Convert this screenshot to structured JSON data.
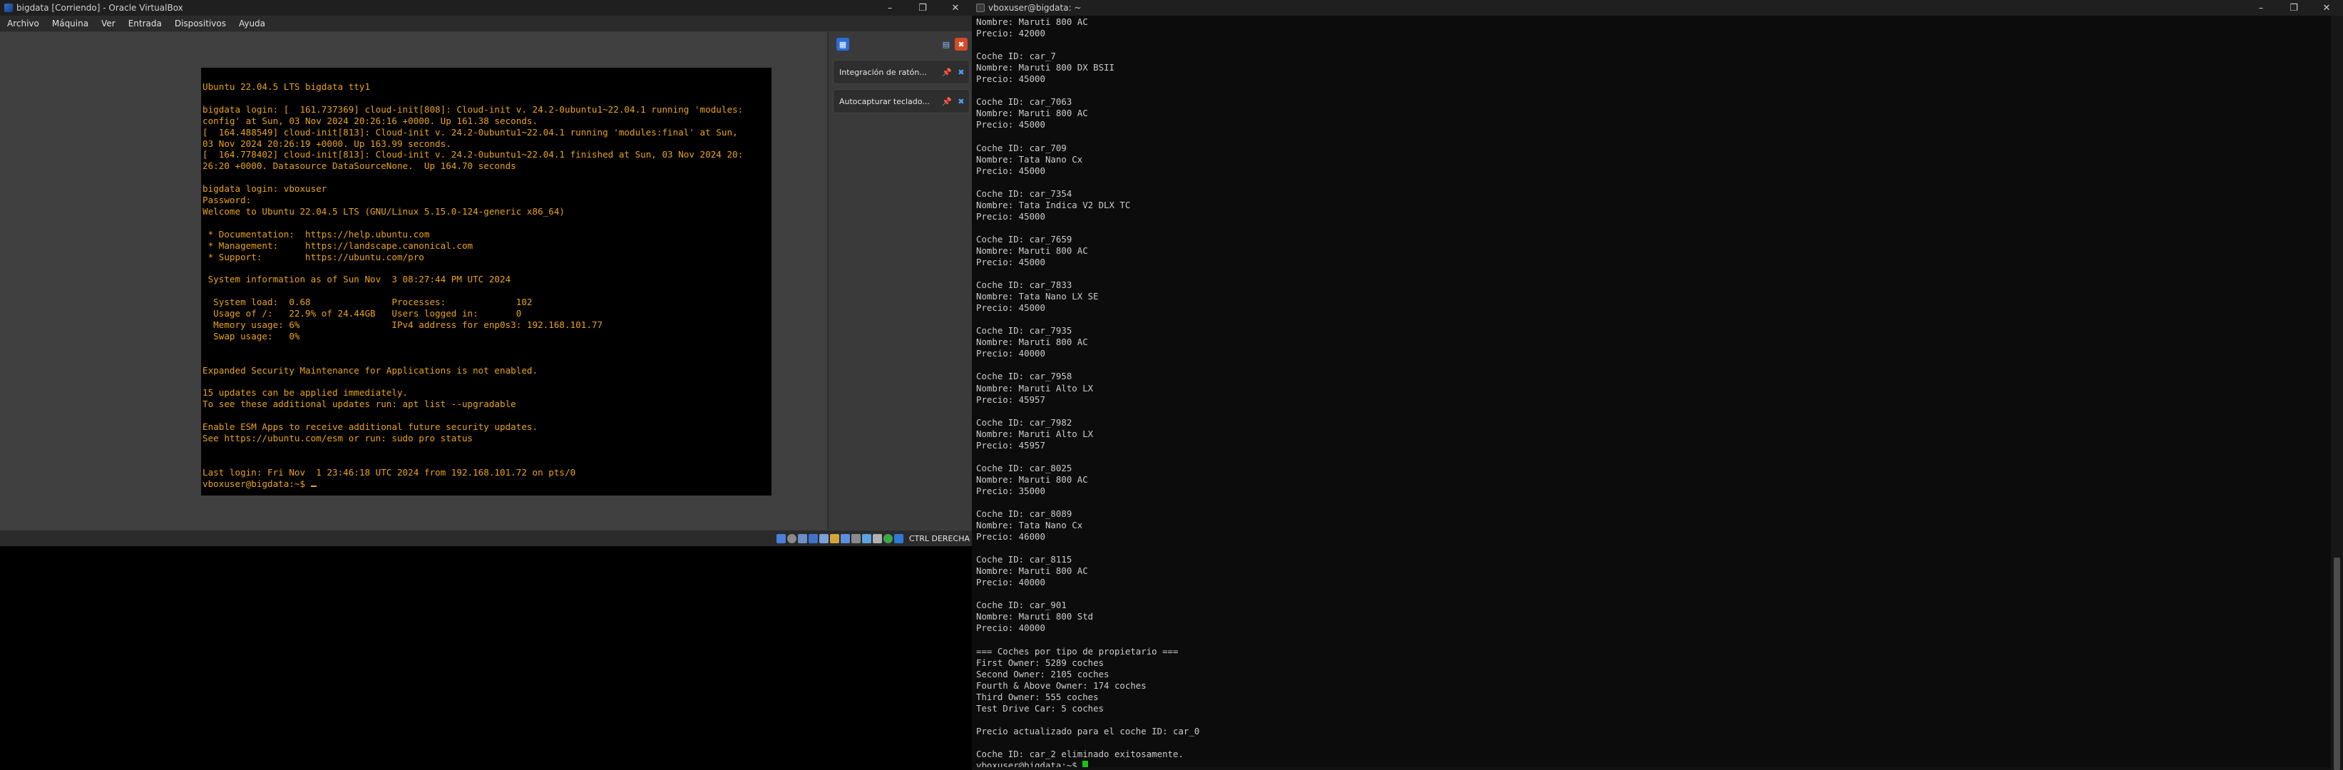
{
  "vbox": {
    "title": "bigdata [Corriendo] - Oracle VirtualBox",
    "menu": [
      "Archivo",
      "Máquina",
      "Ver",
      "Entrada",
      "Dispositivos",
      "Ayuda"
    ],
    "notifications": [
      {
        "text": "Integración de ratón..."
      },
      {
        "text": "Autocapturar teclado..."
      }
    ],
    "host_key": "CTRL DERECHA",
    "console_lines": [
      "Ubuntu 22.04.5 LTS bigdata tty1",
      "",
      "bigdata login: [  161.737369] cloud-init[808]: Cloud-init v. 24.2-0ubuntu1~22.04.1 running 'modules:",
      "config' at Sun, 03 Nov 2024 20:26:16 +0000. Up 161.38 seconds.",
      "[  164.488549] cloud-init[813]: Cloud-init v. 24.2-0ubuntu1~22.04.1 running 'modules:final' at Sun,",
      "03 Nov 2024 20:26:19 +0000. Up 163.99 seconds.",
      "[  164.778402] cloud-init[813]: Cloud-init v. 24.2-0ubuntu1~22.04.1 finished at Sun, 03 Nov 2024 20:",
      "26:20 +0000. Datasource DataSourceNone.  Up 164.70 seconds",
      "",
      "bigdata login: vboxuser",
      "Password:",
      "Welcome to Ubuntu 22.04.5 LTS (GNU/Linux 5.15.0-124-generic x86_64)",
      "",
      " * Documentation:  https://help.ubuntu.com",
      " * Management:     https://landscape.canonical.com",
      " * Support:        https://ubuntu.com/pro",
      "",
      " System information as of Sun Nov  3 08:27:44 PM UTC 2024",
      "",
      "  System load:  0.68               Processes:             102",
      "  Usage of /:   22.9% of 24.44GB   Users logged in:       0",
      "  Memory usage: 6%                 IPv4 address for enp0s3: 192.168.101.77",
      "  Swap usage:   0%",
      "",
      "",
      "Expanded Security Maintenance for Applications is not enabled.",
      "",
      "15 updates can be applied immediately.",
      "To see these additional updates run: apt list --upgradable",
      "",
      "Enable ESM Apps to receive additional future security updates.",
      "See https://ubuntu.com/esm or run: sudo pro status",
      "",
      "",
      "Last login: Fri Nov  1 23:46:18 UTC 2024 from 192.168.101.72 on pts/0"
    ],
    "console_prompt": "vboxuser@bigdata:~$ "
  },
  "terminal": {
    "title": "vboxuser@bigdata: ~",
    "lines": [
      "Nombre: Maruti 800 AC",
      "Precio: 42000",
      "",
      "Coche ID: car_7",
      "Nombre: Maruti 800 DX BSII",
      "Precio: 45000",
      "",
      "Coche ID: car_7063",
      "Nombre: Maruti 800 AC",
      "Precio: 45000",
      "",
      "Coche ID: car_709",
      "Nombre: Tata Nano Cx",
      "Precio: 45000",
      "",
      "Coche ID: car_7354",
      "Nombre: Tata Indica V2 DLX TC",
      "Precio: 45000",
      "",
      "Coche ID: car_7659",
      "Nombre: Maruti 800 AC",
      "Precio: 45000",
      "",
      "Coche ID: car_7833",
      "Nombre: Tata Nano LX SE",
      "Precio: 45000",
      "",
      "Coche ID: car_7935",
      "Nombre: Maruti 800 AC",
      "Precio: 40000",
      "",
      "Coche ID: car_7958",
      "Nombre: Maruti Alto LX",
      "Precio: 45957",
      "",
      "Coche ID: car_7982",
      "Nombre: Maruti Alto LX",
      "Precio: 45957",
      "",
      "Coche ID: car_8025",
      "Nombre: Maruti 800 AC",
      "Precio: 35000",
      "",
      "Coche ID: car_8089",
      "Nombre: Tata Nano Cx",
      "Precio: 46000",
      "",
      "Coche ID: car_8115",
      "Nombre: Maruti 800 AC",
      "Precio: 40000",
      "",
      "Coche ID: car_901",
      "Nombre: Maruti 800 Std",
      "Precio: 40000",
      "",
      "=== Coches por tipo de propietario ===",
      "First Owner: 5289 coches",
      "Second Owner: 2105 coches",
      "Fourth & Above Owner: 174 coches",
      "Third Owner: 555 coches",
      "Test Drive Car: 5 coches",
      "",
      "Precio actualizado para el coche ID: car_0",
      "",
      "Coche ID: car_2 eliminado exitosamente."
    ],
    "prompt": "vboxuser@bigdata:~$ "
  },
  "colors": {
    "console_text": "#e8a317",
    "terminal_text": "#cccccc",
    "terminal_cursor": "#17c317",
    "vm_background": "#404040"
  }
}
